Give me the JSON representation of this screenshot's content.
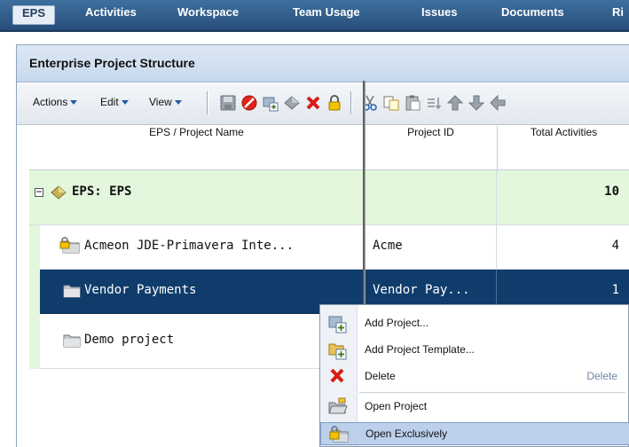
{
  "nav": {
    "tabs": [
      {
        "label": "EPS",
        "active": true
      },
      {
        "label": "Activities"
      },
      {
        "label": "Workspace"
      },
      {
        "label": "Team Usage"
      },
      {
        "label": "Issues"
      },
      {
        "label": "Documents"
      },
      {
        "label": "Ri"
      }
    ]
  },
  "panel": {
    "title": "Enterprise Project Structure"
  },
  "toolbar": {
    "actions_label": "Actions",
    "edit_label": "Edit",
    "view_label": "View",
    "icons": [
      "save-icon",
      "cancel-icon",
      "add-project-icon",
      "add-eps-icon",
      "delete-icon",
      "lock-icon",
      "cut-icon",
      "copy-icon",
      "paste-icon",
      "sort-icon",
      "move-up-icon",
      "move-down-icon",
      "move-left-icon"
    ]
  },
  "grid": {
    "columns": [
      "EPS / Project Name",
      "Project ID",
      "Total Activities"
    ],
    "rows": [
      {
        "name": "EPS: EPS",
        "project_id": "",
        "total": "10",
        "type": "eps",
        "expand": "−"
      },
      {
        "name": "Acmeon JDE-Primavera Inte...",
        "project_id": "Acme",
        "total": "4",
        "type": "project-locked"
      },
      {
        "name": "Vendor Payments",
        "project_id": "Vendor Pay...",
        "total": "1",
        "type": "project",
        "selected": true
      },
      {
        "name": "Demo project",
        "project_id": "",
        "total": "",
        "type": "project"
      }
    ]
  },
  "context_menu": {
    "items": [
      {
        "label": "Add Project...",
        "icon": "add-project-icon"
      },
      {
        "label": "Add Project Template...",
        "icon": "add-template-icon"
      },
      {
        "label": "Delete",
        "icon": "delete-icon",
        "accelerator": "Delete"
      },
      {
        "label": "Open Project",
        "icon": "open-project-icon"
      },
      {
        "label": "Open Exclusively",
        "icon": "open-exclusive-icon",
        "highlighted": true
      }
    ]
  },
  "colors": {
    "nav_bg": "#2f5b87",
    "eps_row_bg": "#e2f7dc",
    "selected_row_bg": "#0f3c6b",
    "menu_highlight": "#bcd0ec"
  }
}
